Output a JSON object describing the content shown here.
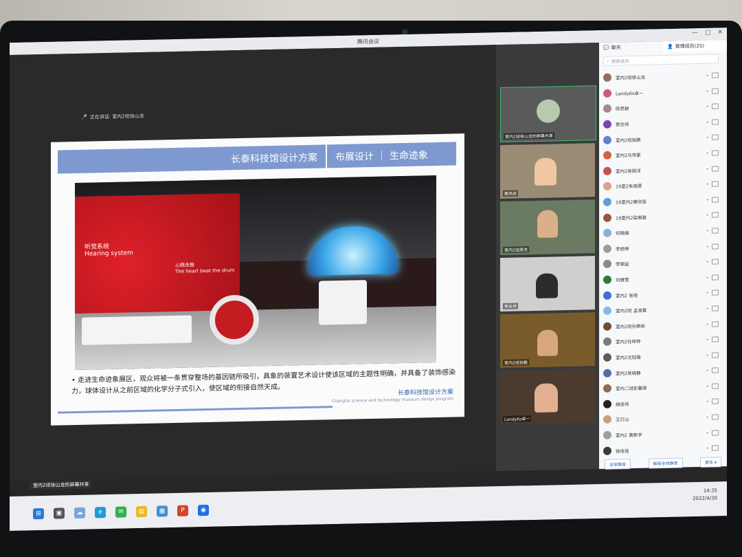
{
  "window": {
    "title": "腾讯会议",
    "controls": [
      "—",
      "▢",
      "✕"
    ]
  },
  "share": {
    "speaking_label": "正在讲话: 室内2班徐山龙",
    "share_label": "室内2班徐山龙的屏幕共享"
  },
  "slide": {
    "title": "长泰科技馆设计方案",
    "section": "布展设计 ｜ 生命迹象",
    "sign_left": "听觉系统\nHearing system",
    "sign_right": "心跳击鼓\nThe heart beat the drum",
    "caption": "• 走进生命迹象展区，观众将被一条贯穿整场的基因链所吸引，具象的装置艺术设计使该区域的主题性明确，并具备了装饰感染力，球体设计从之前区域的化学分子式引入，使区域的衔接自然天成。",
    "footer_cn": "长泰科技馆设计方案",
    "footer_en": "Changtai science and technology museum design program"
  },
  "videos": [
    {
      "name": "室内2班徐山龙的屏幕共享",
      "bg": "#585858"
    },
    {
      "name": "蔡凤尚",
      "bg": "#9a8b74"
    },
    {
      "name": "室内2班周浩",
      "bg": "#6b7a62"
    },
    {
      "name": "贾永伟",
      "bg": "#cfcfcf"
    },
    {
      "name": "室内2班张鹏",
      "bg": "#7a5b2b"
    },
    {
      "name": "Landy6s卓一",
      "bg": "#4b3b2e"
    }
  ],
  "panel": {
    "tab_chat": "聊天",
    "tab_members": "管理成员(25)",
    "search_placeholder": "搜索成员",
    "members": [
      {
        "name": "室内2班徐山龙",
        "color": "#8f6f5a"
      },
      {
        "name": "Landy6s卓一",
        "color": "#d05a7e"
      },
      {
        "name": "陈思颖",
        "color": "#a58a86"
      },
      {
        "name": "贾志伟",
        "color": "#7a45b8"
      },
      {
        "name": "室内2班张鹏",
        "color": "#6082c9"
      },
      {
        "name": "室内2马伟豪",
        "color": "#d4623c"
      },
      {
        "name": "室内2吴刚洋",
        "color": "#c45454"
      },
      {
        "name": "19室2朱晓雯",
        "color": "#d9a38a"
      },
      {
        "name": "19室内2黄欣茹",
        "color": "#5ea0d8"
      },
      {
        "name": "19室内2梁茜雅",
        "color": "#a05040"
      },
      {
        "name": "何晓娟",
        "color": "#8ab0d8"
      },
      {
        "name": "李舒婷",
        "color": "#9c9c9c"
      },
      {
        "name": "李锦益",
        "color": "#8a8a8a"
      },
      {
        "name": "刘雅雪",
        "color": "#2d7a3a"
      },
      {
        "name": "室内2 张悦",
        "color": "#3b6fd6"
      },
      {
        "name": "室内2班 孟淑雷",
        "color": "#88b8e8"
      },
      {
        "name": "室内2班孙希彬",
        "color": "#6d4d3a"
      },
      {
        "name": "室内2任梓铧",
        "color": "#7a7a7a"
      },
      {
        "name": "室内2沈钰璐",
        "color": "#5d5d5d"
      },
      {
        "name": "室内2吴晓静",
        "color": "#4f6f9f"
      },
      {
        "name": "室内二班彭馨荣",
        "color": "#8a6d5a"
      },
      {
        "name": "胡佳伟",
        "color": "#222222"
      },
      {
        "name": "王灯山",
        "color": "#c8a07a"
      },
      {
        "name": "室内2 黄新宇",
        "color": "#9aa0a0"
      },
      {
        "name": "徐佳佳",
        "color": "#3c3c3c"
      }
    ],
    "btn_mute_all": "全体静音",
    "btn_unmute_all": "解除全体静音",
    "btn_more": "更多 ▾"
  },
  "taskbar": {
    "time": "14:35",
    "date": "2022/4/30"
  }
}
